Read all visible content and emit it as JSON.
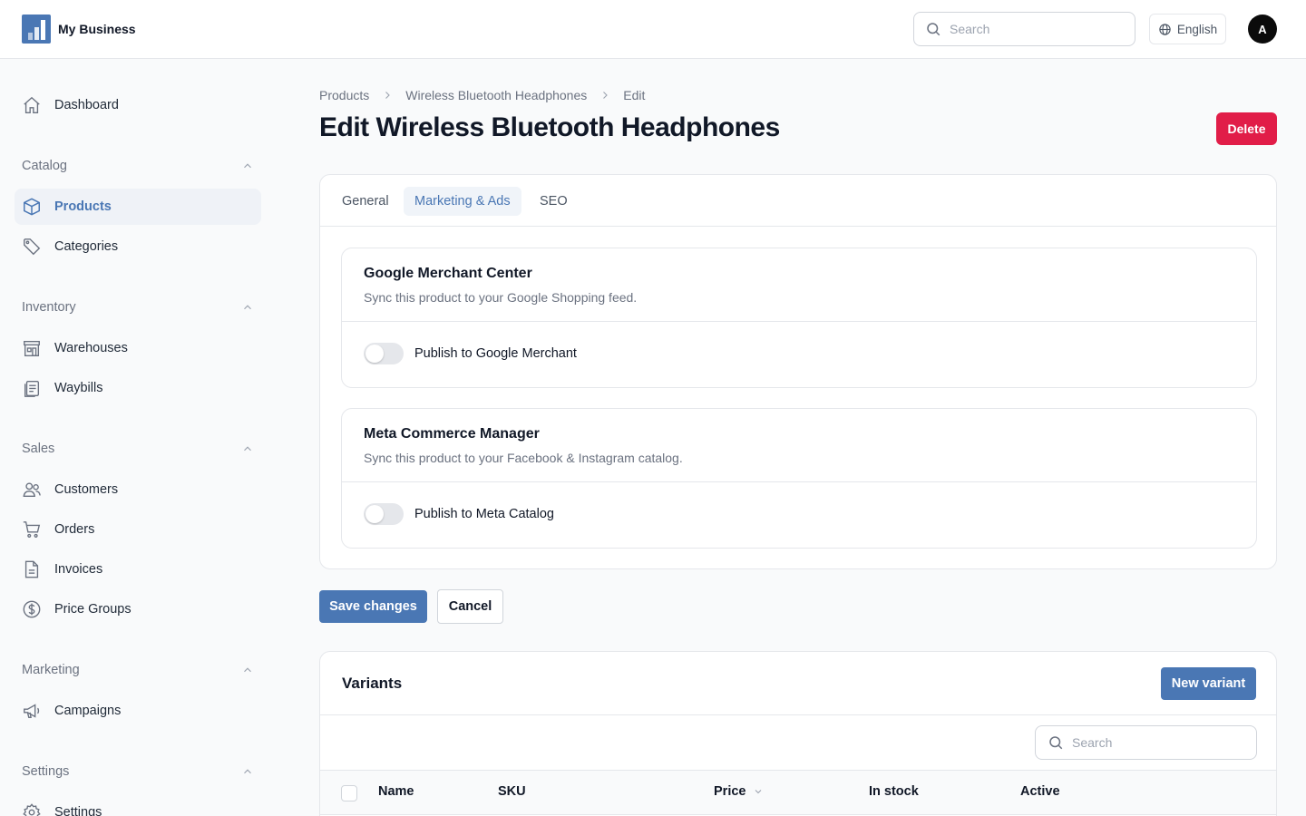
{
  "header": {
    "brand_name": "My Business",
    "search_placeholder": "Search",
    "language": "English",
    "avatar_initial": "A"
  },
  "sidebar": {
    "dashboard": "Dashboard",
    "sections": [
      {
        "title": "Catalog",
        "items": [
          "Products",
          "Categories"
        ]
      },
      {
        "title": "Inventory",
        "items": [
          "Warehouses",
          "Waybills"
        ]
      },
      {
        "title": "Sales",
        "items": [
          "Customers",
          "Orders",
          "Invoices",
          "Price Groups"
        ]
      },
      {
        "title": "Marketing",
        "items": [
          "Campaigns"
        ]
      },
      {
        "title": "Settings",
        "items": [
          "Settings"
        ]
      }
    ],
    "active_item": "Products"
  },
  "breadcrumb": [
    "Products",
    "Wireless Bluetooth Headphones",
    "Edit"
  ],
  "page_title": "Edit Wireless Bluetooth Headphones",
  "delete_label": "Delete",
  "tabs": [
    {
      "label": "General",
      "active": false
    },
    {
      "label": "Marketing & Ads",
      "active": true
    },
    {
      "label": "SEO",
      "active": false
    }
  ],
  "channels": [
    {
      "title": "Google Merchant Center",
      "description": "Sync this product to your Google Shopping feed.",
      "toggle_label": "Publish to Google Merchant",
      "enabled": false
    },
    {
      "title": "Meta Commerce Manager",
      "description": "Sync this product to your Facebook & Instagram catalog.",
      "toggle_label": "Publish to Meta Catalog",
      "enabled": false
    }
  ],
  "actions": {
    "save": "Save changes",
    "cancel": "Cancel"
  },
  "variants": {
    "title": "Variants",
    "new_button": "New variant",
    "search_placeholder": "Search",
    "columns": [
      "Name",
      "SKU",
      "Price",
      "In stock",
      "Active"
    ]
  },
  "colors": {
    "accent": "#4a77b4",
    "danger": "#e11d48"
  }
}
